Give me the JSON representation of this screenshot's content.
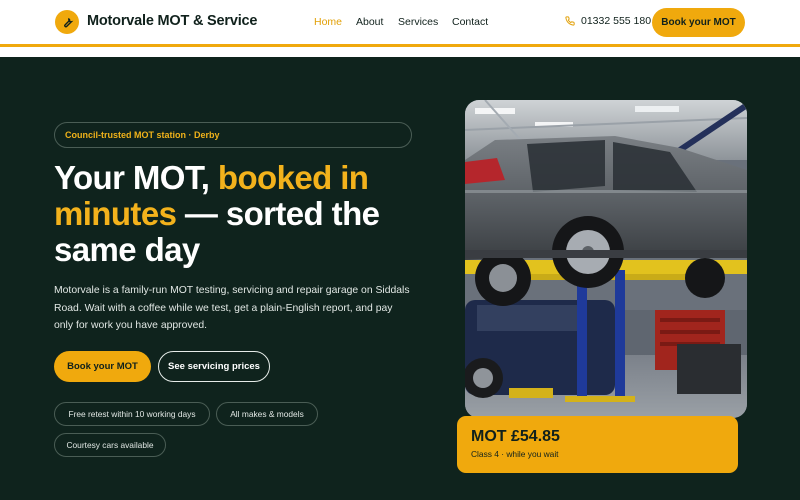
{
  "header": {
    "brand": "Motorvale MOT & Service",
    "nav": [
      "Home",
      "About",
      "Services",
      "Contact"
    ],
    "active_nav": "Home",
    "phone": "01332 555 180",
    "cta": "Book your MOT"
  },
  "hero": {
    "tagline": "Council-trusted MOT station · Derby",
    "headline": {
      "part1": "Your MOT, ",
      "accent": "booked in minutes",
      "part2": " — sorted the same day"
    },
    "description": "Motorvale is a family-run MOT testing, servicing and repair garage on Siddals Road. Wait with a coffee while we test, get a plain-English report, and pay only for work you have approved.",
    "primary_button": "Book your MOT",
    "secondary_button": "See servicing prices",
    "features": [
      "Free retest within 10 working days",
      "All makes & models",
      "Courtesy cars available"
    ]
  },
  "price_card": {
    "title": "MOT £54.85",
    "subtitle": "Class 4 · while you wait"
  },
  "colors": {
    "accent": "#f0a90d",
    "background": "#0f231d",
    "header": "#ffffff",
    "text_dark": "#10211c"
  },
  "icons": {
    "logo": "wrench-icon",
    "phone": "phone-icon"
  }
}
